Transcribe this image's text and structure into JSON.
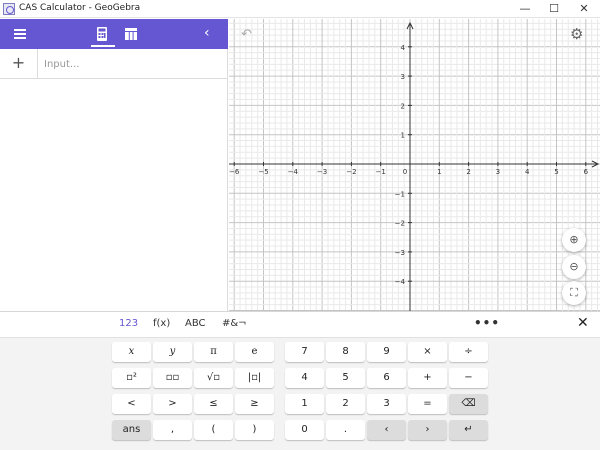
{
  "window": {
    "title": "CAS Calculator - GeoGebra",
    "minimize": "—",
    "maximize": "☐",
    "close": "✕"
  },
  "toolbar": {
    "back": "‹"
  },
  "algebra": {
    "add": "+",
    "input_placeholder": "Input..."
  },
  "graphics": {
    "undo": "↶",
    "settings": "⚙",
    "zoom_in": "⊕",
    "zoom_out": "⊖",
    "fullscreen": "⛶",
    "x_ticks": [
      "−6",
      "−5",
      "−4",
      "−3",
      "−2",
      "−1",
      "0",
      "1",
      "2",
      "3",
      "4",
      "5",
      "6"
    ],
    "y_ticks": [
      "4",
      "3",
      "2",
      "1",
      "−1",
      "−2",
      "−3",
      "−4"
    ]
  },
  "keyboard": {
    "tabs": [
      "123",
      "f(x)",
      "ABC",
      "#&¬"
    ],
    "more": "•••",
    "close": "✕",
    "keys": {
      "x": "x",
      "y": "y",
      "pi": "π",
      "e": "e",
      "7": "7",
      "8": "8",
      "9": "9",
      "times": "×",
      "divide": "÷",
      "squared": "▫²",
      "power": "▫▫",
      "sqrt": "√▫",
      "abs": "|▫|",
      "4": "4",
      "5": "5",
      "6": "6",
      "plus": "+",
      "minus": "−",
      "less": "<",
      "greater": ">",
      "leq": "≤",
      "geq": "≥",
      "1": "1",
      "2": "2",
      "3": "3",
      "equals": "=",
      "backspace": "⌫",
      "ans": "ans",
      "comma": ",",
      "lparen": "(",
      "rparen": ")",
      "0": "0",
      "dot": ".",
      "left": "‹",
      "right": "›",
      "enter": "↵"
    }
  }
}
